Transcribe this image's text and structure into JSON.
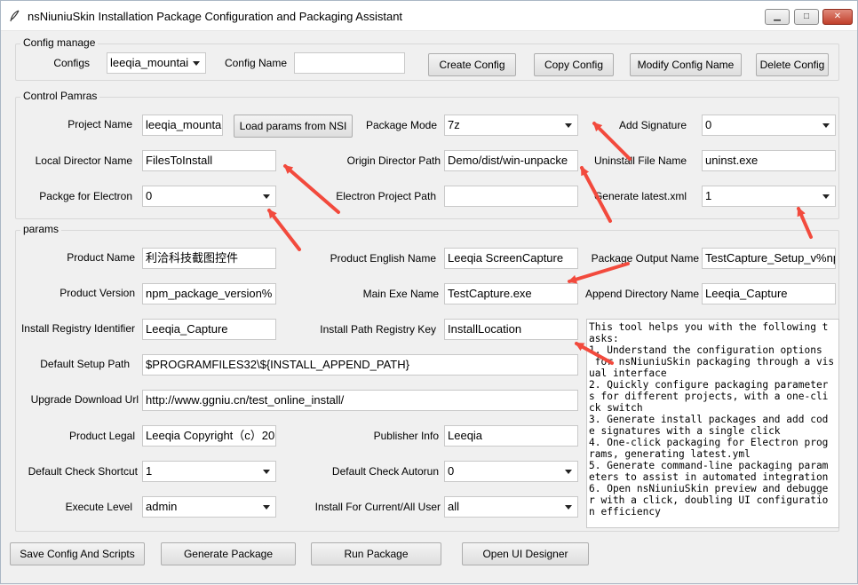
{
  "window": {
    "title": "nsNiuniuSkin Installation Package Configuration and Packaging Assistant",
    "minimize_glyph": "▁",
    "maximize_glyph": "□",
    "close_glyph": "✕"
  },
  "config_manage": {
    "group_label": "Config manage",
    "configs_label": "Configs",
    "configs_value": "leeqia_mountai",
    "config_name_label": "Config Name",
    "config_name_value": "",
    "create_label": "Create Config",
    "copy_label": "Copy Config",
    "modify_label": "Modify Config Name",
    "delete_label": "Delete Config"
  },
  "control_params": {
    "group_label": "Control Pamras",
    "project_name_label": "Project Name",
    "project_name_value": "leeqia_mounta",
    "load_params_label": "Load params from NSI",
    "package_mode_label": "Package Mode",
    "package_mode_value": "7z",
    "add_signature_label": "Add Signature",
    "add_signature_value": "0",
    "local_dir_label": "Local Director Name",
    "local_dir_value": "FilesToInstall",
    "origin_dir_label": "Origin Director Path",
    "origin_dir_value": "Demo/dist/win-unpacke",
    "uninstall_file_label": "Uninstall File Name",
    "uninstall_file_value": "uninst.exe",
    "electron_label": "Packge for Electron",
    "electron_value": "0",
    "electron_path_label": "Electron Project Path",
    "electron_path_value": "",
    "gen_latest_label": "Generate latest.xml",
    "gen_latest_value": "1"
  },
  "params": {
    "group_label": "params",
    "product_name_label": "Product Name",
    "product_name_value": "利洽科技截图控件",
    "product_en_label": "Product English Name",
    "product_en_value": "Leeqia ScreenCapture",
    "output_name_label": "Package Output Name",
    "output_name_value": "TestCapture_Setup_v%np",
    "product_version_label": "Product Version",
    "product_version_value": "npm_package_version%",
    "main_exe_label": "Main Exe Name",
    "main_exe_value": "TestCapture.exe",
    "append_dir_label": "Append Directory Name",
    "append_dir_value": "Leeqia_Capture",
    "registry_id_label": "Install Registry Identifier",
    "registry_id_value": "Leeqia_Capture",
    "install_path_key_label": "Install Path Registry Key",
    "install_path_key_value": "InstallLocation",
    "default_setup_label": "Default Setup Path",
    "default_setup_value": "$PROGRAMFILES32\\${INSTALL_APPEND_PATH}",
    "upgrade_url_label": "Upgrade Download Url",
    "upgrade_url_value": "http://www.ggniu.cn/test_online_install/",
    "product_legal_label": "Product Legal",
    "product_legal_value": "Leeqia Copyright（c）20",
    "publisher_label": "Publisher Info",
    "publisher_value": "Leeqia",
    "check_shortcut_label": "Default Check Shortcut",
    "check_shortcut_value": "1",
    "check_autorun_label": "Default Check Autorun",
    "check_autorun_value": "0",
    "exec_level_label": "Execute Level",
    "exec_level_value": "admin",
    "install_for_label": "Install For Current/All User",
    "install_for_value": "all",
    "info_text": "This tool helps you with the following t\nasks:\n1. Understand the configuration options\n for nsNiuniuSkin packaging through a vis\nual interface\n2. Quickly configure packaging parameter\ns for different projects, with a one-cli\nck switch\n3. Generate install packages and add cod\ne signatures with a single click\n4. One-click packaging for Electron prog\nrams, generating latest.yml\n5. Generate command-line packaging param\neters to assist in automated integration\n6. Open nsNiuniuSkin preview and debugge\nr with a click, doubling UI configuratio\nn efficiency"
  },
  "bottom_bar": {
    "save_label": "Save Config And Scripts",
    "generate_label": "Generate Package",
    "run_label": "Run Package",
    "designer_label": "Open UI Designer"
  },
  "colors": {
    "annotation_arrow": "#f24a3d",
    "window_bg": "#f0f0f0",
    "close_button": "#c1402c"
  }
}
